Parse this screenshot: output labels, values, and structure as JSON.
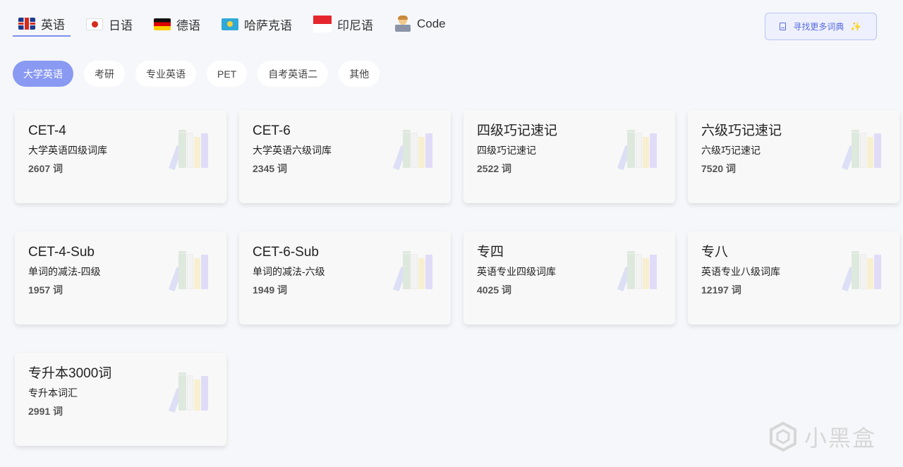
{
  "languages": [
    {
      "label": "英语",
      "flag": "uk",
      "active": true
    },
    {
      "label": "日语",
      "flag": "jp"
    },
    {
      "label": "德语",
      "flag": "de"
    },
    {
      "label": "哈萨克语",
      "flag": "kz"
    },
    {
      "label": "印尼语",
      "flag": "id"
    },
    {
      "label": "Code",
      "flag": "code"
    }
  ],
  "find_button": {
    "label": "寻找更多词典",
    "sparkle": "✨"
  },
  "categories": [
    {
      "label": "大学英语",
      "active": true
    },
    {
      "label": "考研"
    },
    {
      "label": "专业英语"
    },
    {
      "label": "PET"
    },
    {
      "label": "自考英语二"
    },
    {
      "label": "其他"
    }
  ],
  "dictionaries": [
    {
      "title": "CET-4",
      "desc": "大学英语四级词库",
      "count": "2607 词"
    },
    {
      "title": "CET-6",
      "desc": "大学英语六级词库",
      "count": "2345 词"
    },
    {
      "title": "四级巧记速记",
      "desc": "四级巧记速记",
      "count": "2522 词"
    },
    {
      "title": "六级巧记速记",
      "desc": "六级巧记速记",
      "count": "7520 词"
    },
    {
      "title": "CET-4-Sub",
      "desc": "单词的减法-四级",
      "count": "1957 词"
    },
    {
      "title": "CET-6-Sub",
      "desc": "单词的减法-六级",
      "count": "1949 词"
    },
    {
      "title": "专四",
      "desc": "英语专业四级词库",
      "count": "4025 词"
    },
    {
      "title": "专八",
      "desc": "英语专业八级词库",
      "count": "12197 词"
    },
    {
      "title": "专升本3000词",
      "desc": "专升本词汇",
      "count": "2991 词"
    }
  ],
  "watermark": {
    "text": "小黑盒"
  },
  "colors": {
    "accent": "#8a9af2",
    "find_button_text": "#5a6adf",
    "background": "#f6f7fa"
  }
}
